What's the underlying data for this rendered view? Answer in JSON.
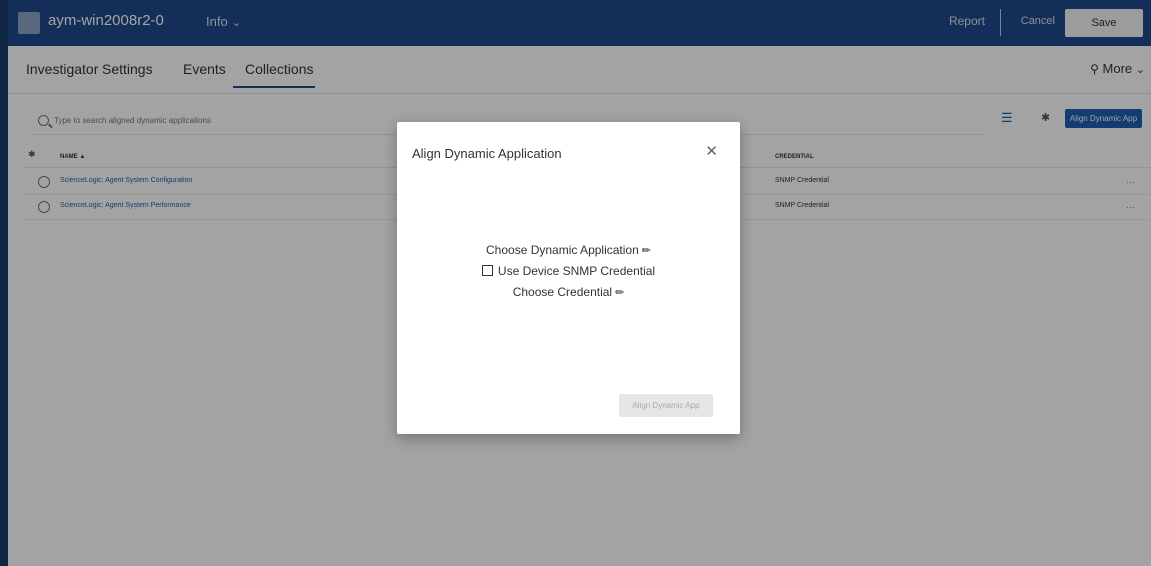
{
  "header": {
    "device_name": "aym-win2008r2-0",
    "info_menu": "Info",
    "report": "Report",
    "cancel": "Cancel",
    "save": "Save"
  },
  "tabs": [
    {
      "label": "Investigator",
      "active": false
    },
    {
      "label": "Settings",
      "active": false
    },
    {
      "label": "Events",
      "active": false
    },
    {
      "label": "Collections",
      "active": true
    }
  ],
  "more_menu": "More",
  "toolbar": {
    "search_placeholder": "Type to search aligned dynamic applications",
    "align_button": "Align Dynamic App"
  },
  "table": {
    "columns": [
      "NAME",
      "CREDENTIAL"
    ],
    "rows": [
      {
        "name": "ScienceLogic: Agent System Configuration",
        "credential": "SNMP Credential",
        "menu": "…"
      },
      {
        "name": "ScienceLogic: Agent System Performance",
        "credential": "SNMP Credential",
        "menu": "…"
      }
    ]
  },
  "modal": {
    "title": "Align Dynamic Application",
    "choose_app": "Choose Dynamic Application",
    "use_snmp": "Use Device SNMP Credential",
    "use_snmp_checked": false,
    "choose_credential": "Choose Credential",
    "submit": "Align Dynamic App"
  },
  "colors": {
    "primary": "#1e4a8c",
    "link": "#1e5fb4",
    "overlay": "rgba(0,0,0,0.36)"
  }
}
